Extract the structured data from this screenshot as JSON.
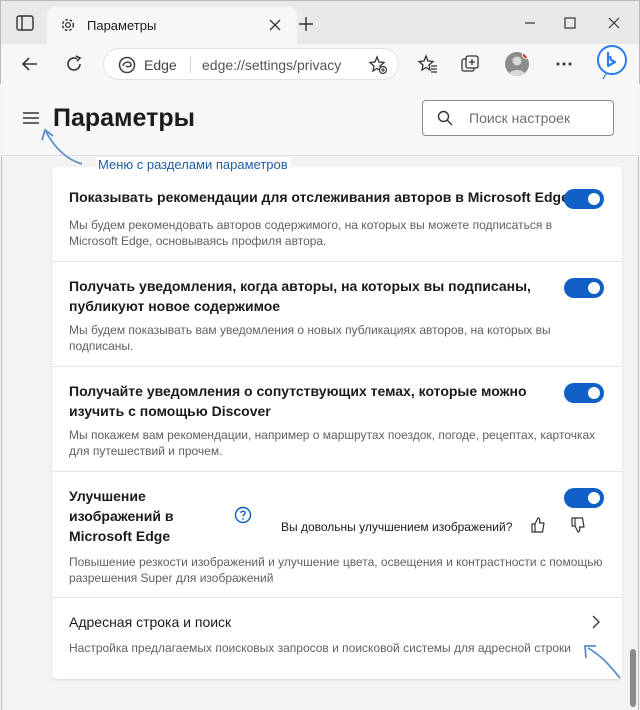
{
  "browser": {
    "tab_title": "Параметры",
    "omnibox": {
      "site": "Edge",
      "url": "edge://settings/privacy"
    }
  },
  "settings": {
    "title": "Параметры",
    "search_placeholder": "Поиск настроек",
    "menu_caption": "Меню с разделами параметров",
    "rows": [
      {
        "label_lines": [
          "Показывать рекомендации для отслеживания авторов в Microsoft Edge"
        ],
        "desc_lines": [
          "Мы будем рекомендовать авторов содержимого, на которых вы можете подписаться в",
          "Microsoft Edge, основываясь профиля автора."
        ],
        "toggle": "on"
      },
      {
        "label_lines": [
          "Получать уведомления, когда авторы, на которых вы подписаны,",
          "публикуют новое содержимое"
        ],
        "desc_lines": [
          "Мы будем показывать вам уведомления о новых публикациях авторов, на которых вы",
          "подписаны."
        ],
        "toggle": "on"
      },
      {
        "label_lines": [
          "Получайте уведомления о сопутствующих темах, которые можно",
          "изучить с помощью Discover"
        ],
        "desc_lines": [
          "Мы покажем вам рекомендации, например о маршрутах поездок, погоде, рецептах, карточках",
          "для путешествий и прочем."
        ],
        "toggle": "on"
      },
      {
        "label_lines": [
          "Улучшение",
          "изображений в",
          "Microsoft Edge"
        ],
        "feedback": "Вы довольны улучшением изображений?",
        "desc_lines": [
          "Повышение резкости изображений и улучшение цвета, освещения и контрастности с помощью",
          "разрешения Super для изображений"
        ],
        "toggle": "on"
      },
      {
        "label_lines": [
          "Адресная строка и поиск"
        ],
        "desc_lines": [
          "Настройка предлагаемых поисковых запросов и поисковой системы для адресной строки"
        ]
      }
    ]
  },
  "colors": {
    "accent": "#0f5fc6",
    "link": "#1f5fa8",
    "annotation_arrow": "#5b8fc7"
  },
  "icons": [
    "tab-actions-icon",
    "gear-icon",
    "close-icon",
    "new-tab-icon",
    "minimize-icon",
    "maximize-icon",
    "window-close-icon",
    "back-icon",
    "refresh-icon",
    "edge-logo-icon",
    "add-favorite-icon",
    "favorites-icon",
    "collections-icon",
    "avatar-icon",
    "more-icon",
    "bing-icon",
    "hamburger-icon",
    "search-icon",
    "help-icon",
    "thumbs-up-icon",
    "thumbs-down-icon",
    "chevron-right-icon"
  ]
}
